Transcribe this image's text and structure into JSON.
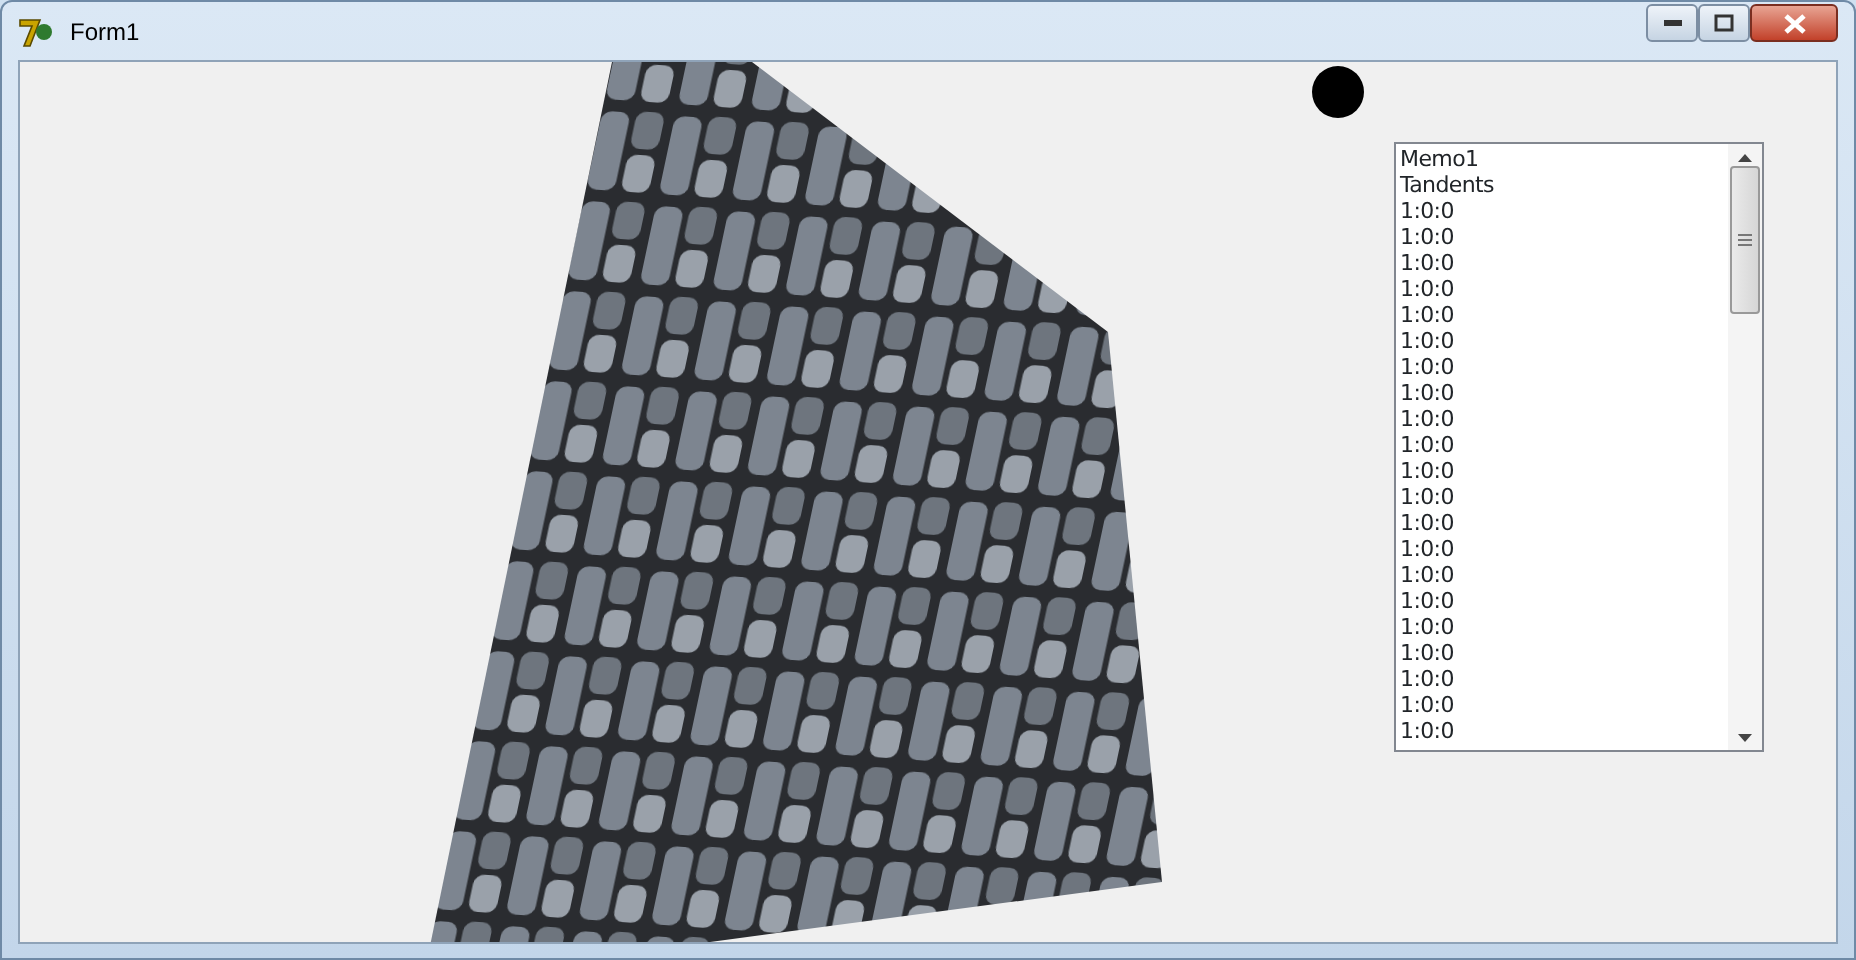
{
  "window": {
    "title": "Form1"
  },
  "memo": {
    "lines": [
      "Memo1",
      "Tandents",
      "1:0:0",
      "1:0:0",
      "1:0:0",
      "1:0:0",
      "1:0:0",
      "1:0:0",
      "1:0:0",
      "1:0:0",
      "1:0:0",
      "1:0:0",
      "1:0:0",
      "1:0:0",
      "1:0:0",
      "1:0:0",
      "1:0:0",
      "1:0:0",
      "1:0:0",
      "1:0:0",
      "1:0:0",
      "1:0:0",
      "1:0:0"
    ]
  }
}
